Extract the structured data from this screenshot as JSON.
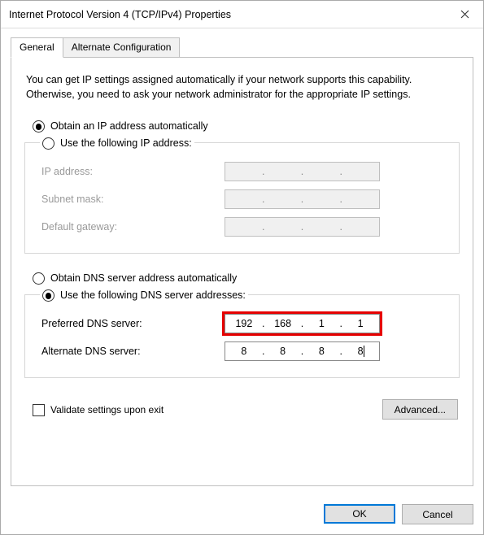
{
  "window": {
    "title": "Internet Protocol Version 4 (TCP/IPv4) Properties"
  },
  "tabs": {
    "general": "General",
    "alternate": "Alternate Configuration"
  },
  "intro": "You can get IP settings assigned automatically if your network supports this capability. Otherwise, you need to ask your network administrator for the appropriate IP settings.",
  "ip_section": {
    "auto_label": "Obtain an IP address automatically",
    "manual_label": "Use the following IP address:",
    "ip_label": "IP address:",
    "subnet_label": "Subnet mask:",
    "gateway_label": "Default gateway:",
    "auto_selected": true
  },
  "dns_section": {
    "auto_label": "Obtain DNS server address automatically",
    "manual_label": "Use the following DNS server addresses:",
    "preferred_label": "Preferred DNS server:",
    "alternate_label": "Alternate DNS server:",
    "manual_selected": true,
    "preferred": {
      "o1": "192",
      "o2": "168",
      "o3": "1",
      "o4": "1"
    },
    "alternate": {
      "o1": "8",
      "o2": "8",
      "o3": "8",
      "o4": "8"
    }
  },
  "validate_label": "Validate settings upon exit",
  "buttons": {
    "advanced": "Advanced...",
    "ok": "OK",
    "cancel": "Cancel"
  },
  "dot": "."
}
